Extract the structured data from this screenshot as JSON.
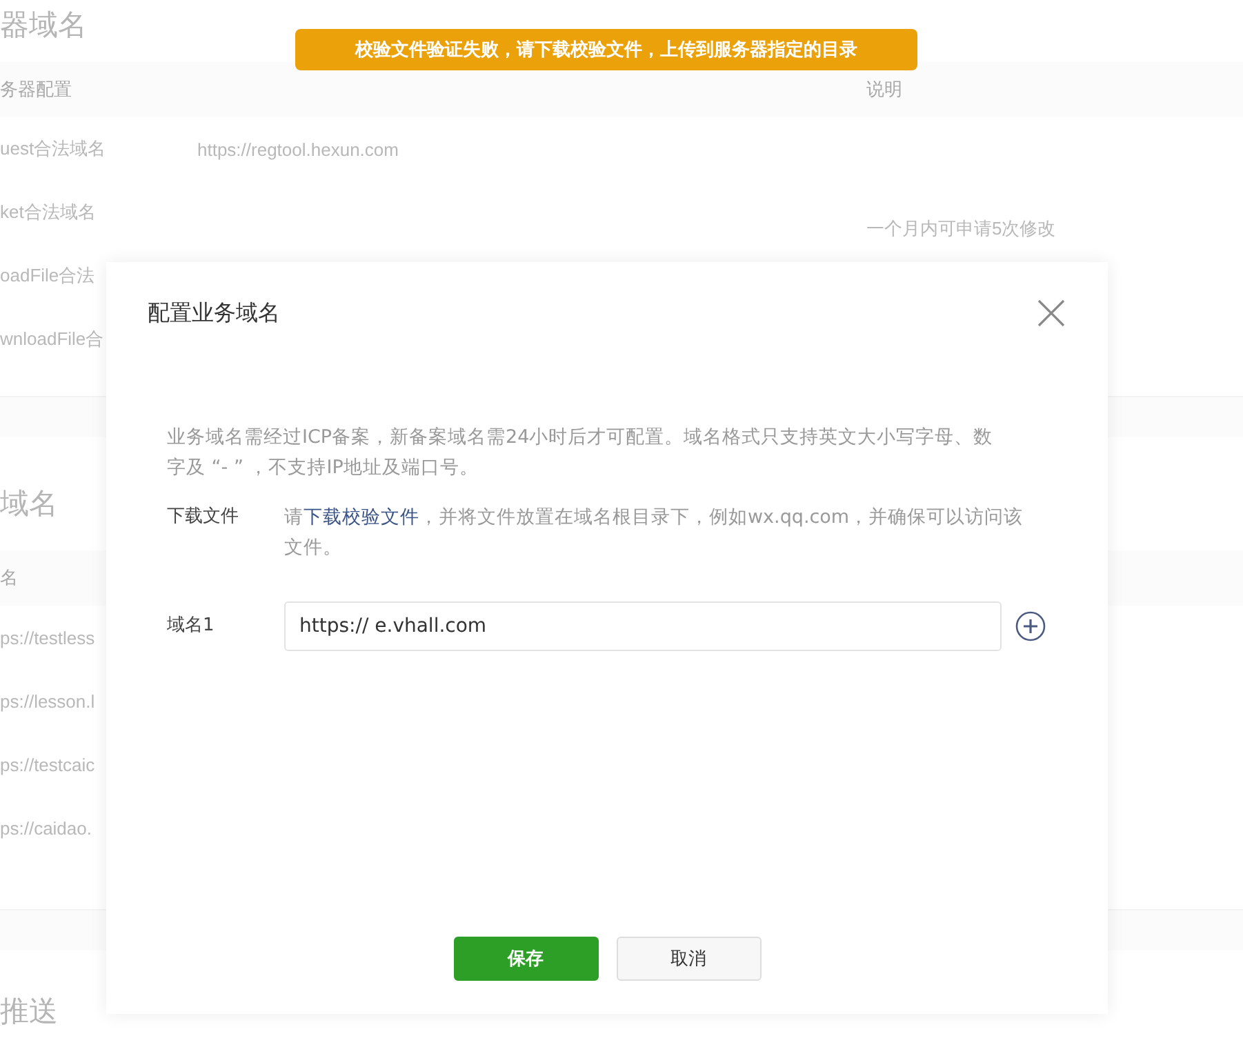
{
  "page": {
    "server_section": {
      "title": "器域名",
      "columns": [
        "务器配置",
        "说明"
      ],
      "rows": [
        {
          "name": "uest合法域名",
          "value": "https://regtool.hexun.com"
        },
        {
          "name": "ket合法域名",
          "note": "一个月内可申请5次修改"
        },
        {
          "name": "oadFile合法"
        },
        {
          "name": "wnloadFile合"
        }
      ]
    },
    "business_section": {
      "title": "域名",
      "columns": [
        "名"
      ],
      "rows": [
        {
          "name": "ps://testless"
        },
        {
          "name": "ps://lesson.l"
        },
        {
          "name": "ps://testcaic"
        },
        {
          "name": "ps://caidao."
        }
      ]
    },
    "push_section": {
      "title": "推送"
    }
  },
  "toast": {
    "text": "校验文件验证失败，请下载校验文件，上传到服务器指定的目录"
  },
  "dialog": {
    "title": "配置业务域名",
    "description": "业务域名需经过ICP备案，新备案域名需24小时后才可配置。域名格式只支持英文大小写字母、数字及 “- ” ，不支持IP地址及端口号。",
    "download": {
      "label": "下载文件",
      "prefix": "请",
      "link": "下载校验文件",
      "suffix": "，并将文件放置在域名根目录下，例如wx.qq.com，并确保可以访问该文件。"
    },
    "domains": [
      {
        "label": "域名1",
        "value": "https:// e.vhall.com"
      }
    ],
    "buttons": [
      {
        "label": "保存",
        "kind": "primary"
      },
      {
        "label": "取消",
        "kind": "secondary"
      }
    ]
  }
}
